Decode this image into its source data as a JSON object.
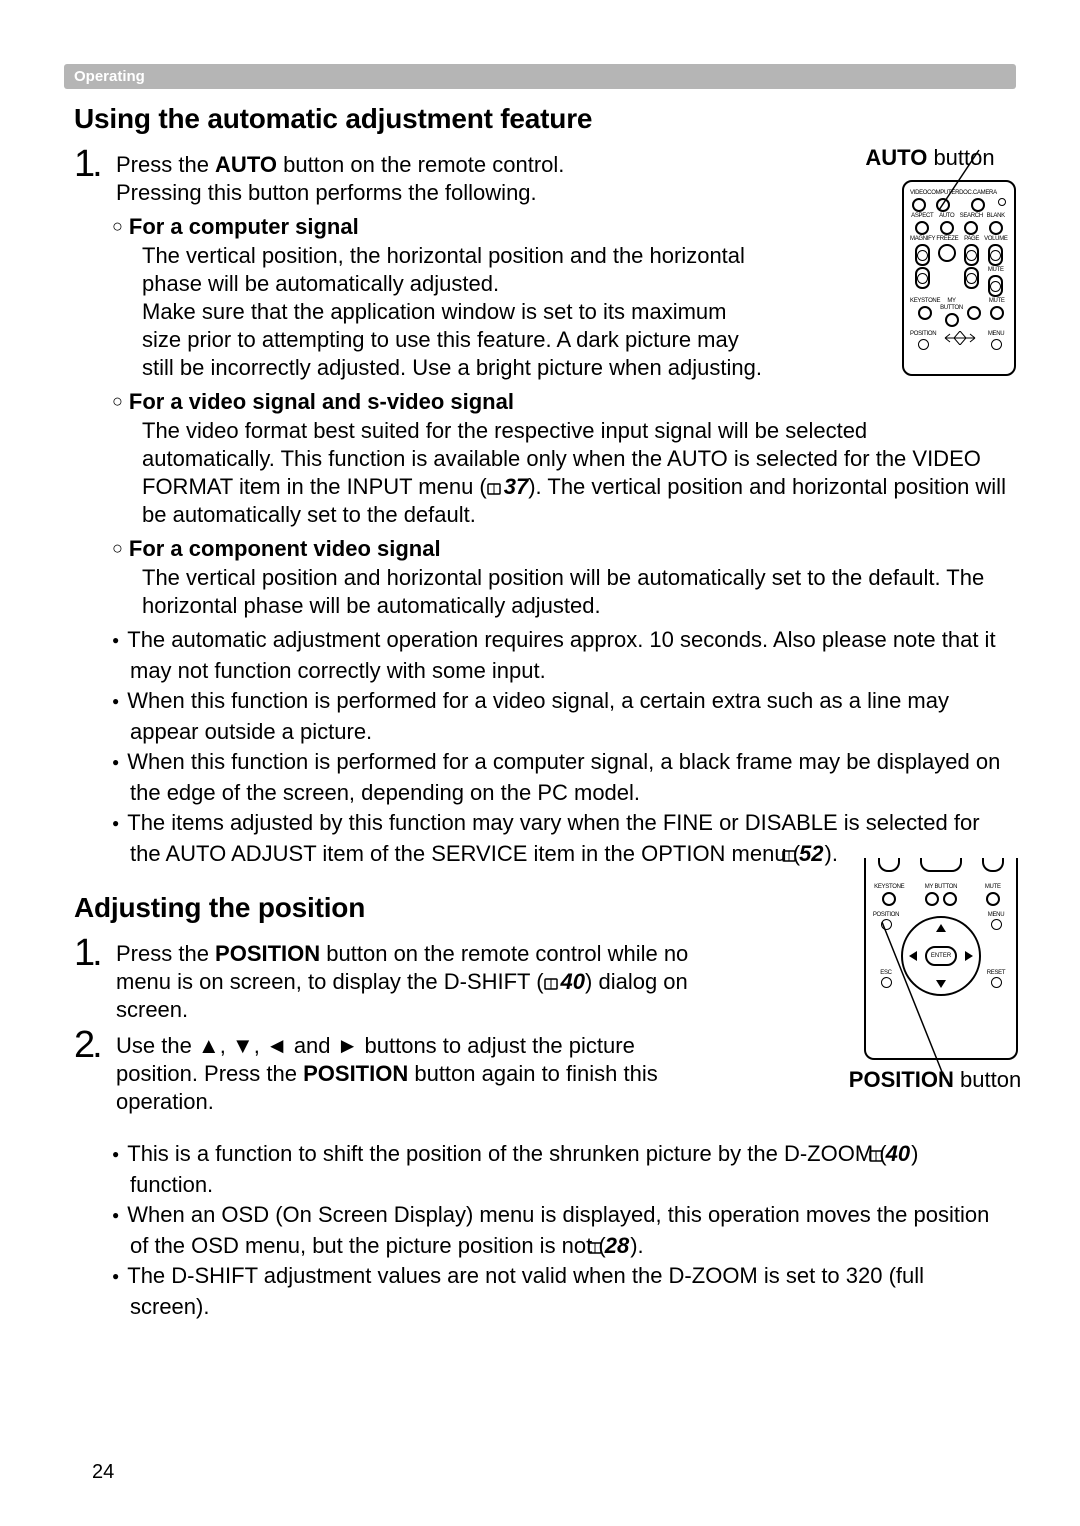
{
  "section_bar": "Operating",
  "auto": {
    "title": "Using the automatic adjustment feature",
    "caption_prefix": "AUTO",
    "caption_suffix": " button",
    "step1_a": "Press the ",
    "step1_b": "AUTO",
    "step1_c": " button on the remote control.",
    "step1_d": "Pressing this button performs the following.",
    "sub1_head": "For a computer signal",
    "sub1_body": "The vertical position, the horizontal position and the horizontal phase will be automatically adjusted.\nMake sure that the application window is set to its maximum size prior to attempting to use this feature. A dark picture may still be incorrectly adjusted. Use a bright picture when adjusting.",
    "sub2_head": "For a video signal and s-video signal",
    "sub2_body_a": "The video format best suited for the respective input signal will be selected automatically. This function is available only when the AUTO is selected for the VIDEO FORMAT item in the INPUT menu (",
    "sub2_ref": "37",
    "sub2_body_b": "). The vertical position and horizontal position will be automatically set to the default.",
    "sub3_head": "For a component video signal",
    "sub3_body": "The vertical position and horizontal position will be automatically set to the default. The horizontal phase will be automatically adjusted.",
    "bullets": [
      {
        "a": "The automatic adjustment operation requires approx. 10 seconds. Also please note that it may not function correctly with some input."
      },
      {
        "a": "When this function is performed for a video signal, a certain extra such as a line may appear outside a picture."
      },
      {
        "a": "When this function is performed for a computer signal, a black frame may be displayed on the edge of the screen, depending on the PC model."
      },
      {
        "a": "The items adjusted by this function may vary when the FINE or DISABLE is selected for the AUTO ADJUST item of the SERVICE item in the OPTION menu (",
        "ref": "52",
        "b": ")."
      }
    ]
  },
  "position": {
    "title": "Adjusting the position",
    "caption_prefix": "POSITION",
    "caption_suffix": " button",
    "step1_a": "Press the ",
    "step1_b": "POSITION",
    "step1_c": " button on the remote control while no menu is on screen, to display the D-SHIFT (",
    "step1_ref": "40",
    "step1_d": ") dialog on screen.",
    "step2": "Use the ▲, ▼, ◄ and ► buttons to adjust the picture position. Press the ",
    "step2_b": "POSITION",
    "step2_c": " button again to finish this operation.",
    "bullets": [
      {
        "a": "This is a function to shift the position of the shrunken picture by the D-ZOOM (",
        "ref": "40",
        "b": ") function."
      },
      {
        "a": "When an OSD (On Screen Display) menu is displayed, this operation moves the position of the OSD menu, but the picture position is not (",
        "ref": "28",
        "b": ")."
      },
      {
        "a": "The D-SHIFT adjustment values are not valid when the D-ZOOM is set to 320 (full screen)."
      }
    ]
  },
  "remote_labels_top": [
    [
      "VIDEO",
      "COMPUTER",
      "DOC.CAMERA",
      ""
    ],
    [
      "ASPECT",
      "AUTO",
      "SEARCH",
      "BLANK"
    ],
    [
      "MAGNIFY",
      "FREEZE",
      "PAGE",
      "VOLUME"
    ],
    [
      "",
      "",
      "",
      "MUTE"
    ],
    [
      "KEYSTONE",
      "MY BUTTON",
      "",
      "MUTE"
    ],
    [
      "POSITION",
      "",
      "",
      "MENU"
    ]
  ],
  "remote_labels_bot": {
    "row1": [
      "KEYSTONE",
      "MY BUTTON",
      "",
      "MUTE"
    ],
    "pos": "POSITION",
    "menu": "MENU",
    "enter": "ENTER",
    "esc": "ESC",
    "reset": "RESET"
  },
  "page_number": "24"
}
